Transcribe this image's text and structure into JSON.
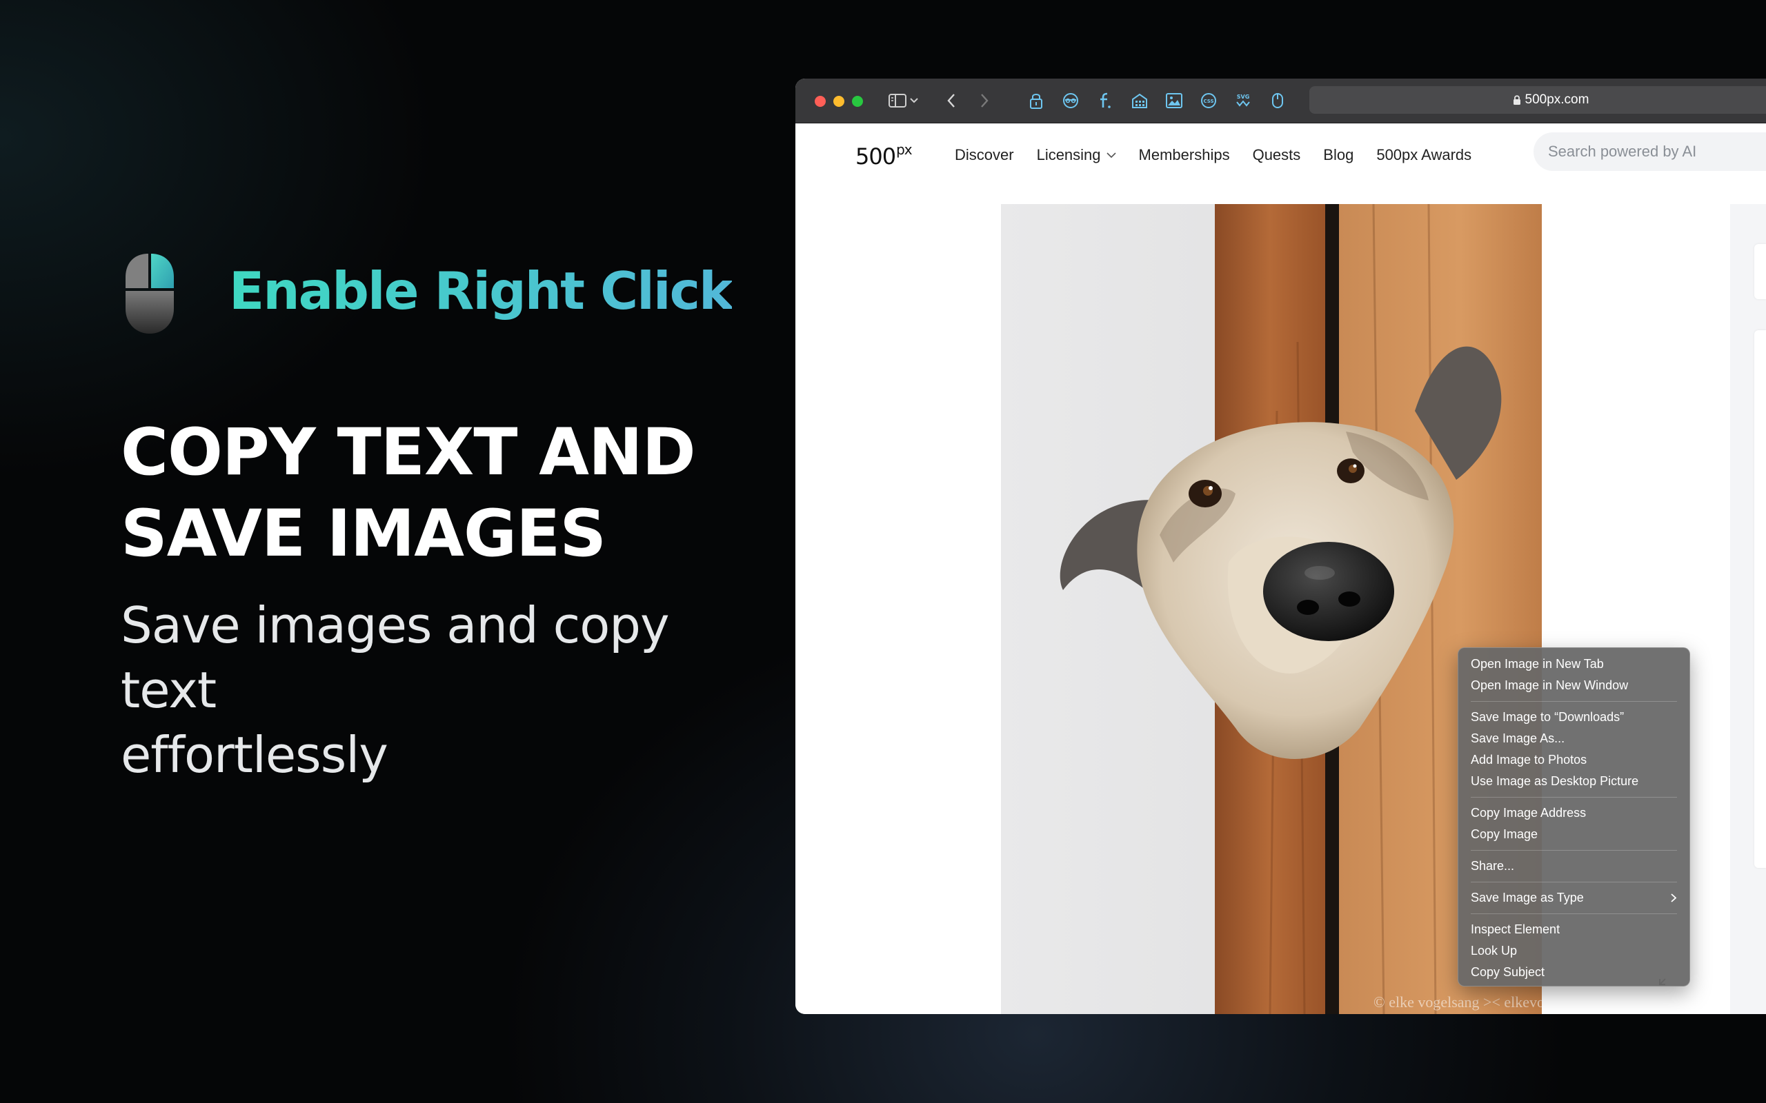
{
  "promo": {
    "app_name": "Enable Right Click",
    "headline_line1": "COPY TEXT AND",
    "headline_line2": "SAVE IMAGES",
    "subline_line1": "Save images and copy text",
    "subline_line2": "effortlessly"
  },
  "browser": {
    "url": "500px.com",
    "toolbar_icons": [
      "lock-icon",
      "eye-icon",
      "f-icon",
      "building-icon",
      "image-icon",
      "css-icon",
      "svg-icon",
      "mouse-icon"
    ]
  },
  "site": {
    "logo_text": "500",
    "logo_sup": "px",
    "nav": {
      "discover": "Discover",
      "licensing": "Licensing",
      "memberships": "Memberships",
      "quests": "Quests",
      "blog": "Blog",
      "awards": "500px Awards"
    },
    "search_placeholder": "Search powered by AI",
    "photo_credit": "© elke vogelsang >< elkevogelsang.com"
  },
  "context_menu": {
    "open_new_tab": "Open Image in New Tab",
    "open_new_window": "Open Image in New Window",
    "save_downloads": "Save Image to “Downloads”",
    "save_as": "Save Image As...",
    "add_photos": "Add Image to Photos",
    "desktop_picture": "Use Image as Desktop Picture",
    "copy_address": "Copy Image Address",
    "copy_image": "Copy Image",
    "share": "Share...",
    "save_as_type": "Save Image as Type",
    "inspect": "Inspect Element",
    "look_up": "Look Up",
    "copy_subject": "Copy Subject"
  },
  "colors": {
    "title_gradient_start": "#3fd8c2",
    "title_gradient_end": "#52b8d8",
    "traffic_red": "#ff5f57",
    "traffic_yellow": "#febc2e",
    "traffic_green": "#28c840",
    "toolbar_icon": "#6ec6f0"
  }
}
